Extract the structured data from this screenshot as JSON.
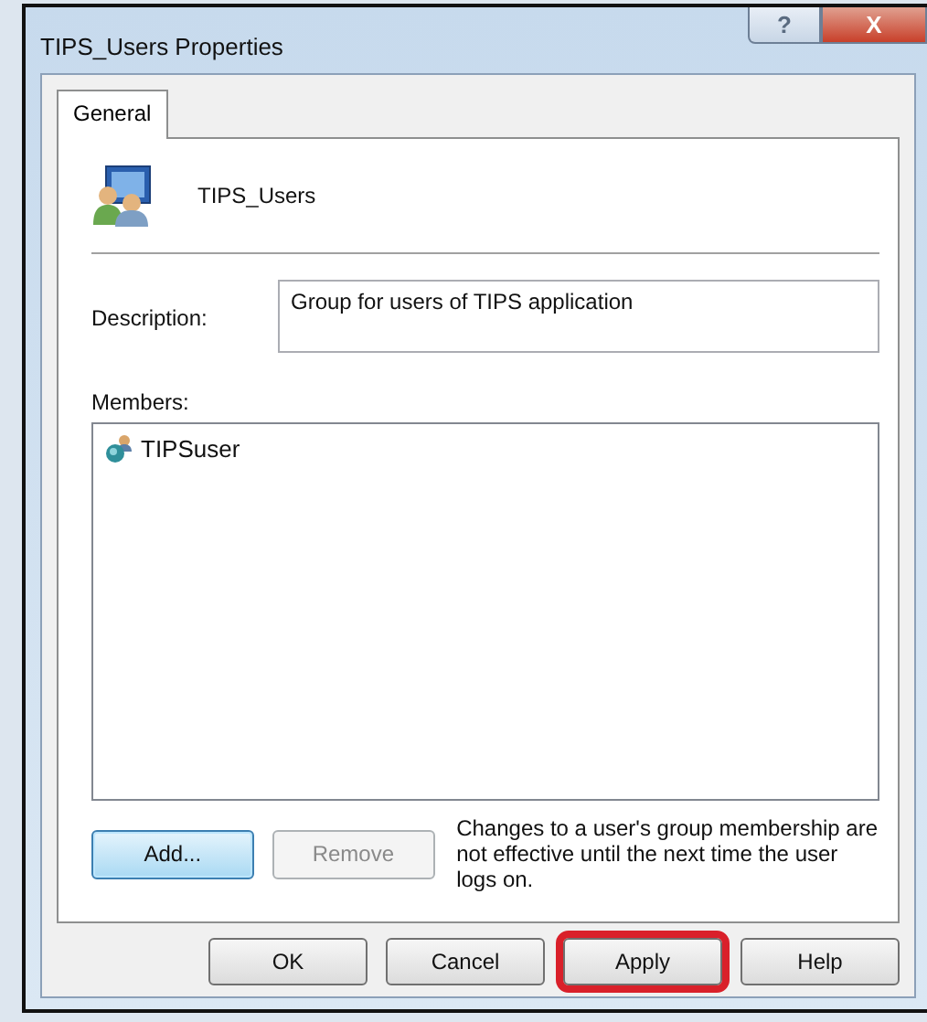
{
  "window": {
    "title": "TIPS_Users Properties",
    "controls": [
      {
        "kind": "help",
        "label": "?"
      },
      {
        "kind": "close",
        "label": "X"
      }
    ]
  },
  "tabs": [
    {
      "label": "General",
      "selected": true
    }
  ],
  "group": {
    "name": "TIPS_Users"
  },
  "description": {
    "label": "Description:",
    "value": "Group for users of TIPS application"
  },
  "members": {
    "label": "Members:",
    "items": [
      {
        "name": "TIPSuser",
        "selected": false
      }
    ]
  },
  "member_buttons": [
    {
      "label": "Add...",
      "default": true,
      "disabled": false
    },
    {
      "label": "Remove",
      "default": false,
      "disabled": true
    }
  ],
  "note": "Changes to a user's group membership are not effective until the next time the user logs on.",
  "buttons": [
    {
      "label": "OK",
      "highlighted": false
    },
    {
      "label": "Cancel",
      "highlighted": false
    },
    {
      "label": "Apply",
      "highlighted": true
    },
    {
      "label": "Help",
      "highlighted": false
    }
  ]
}
